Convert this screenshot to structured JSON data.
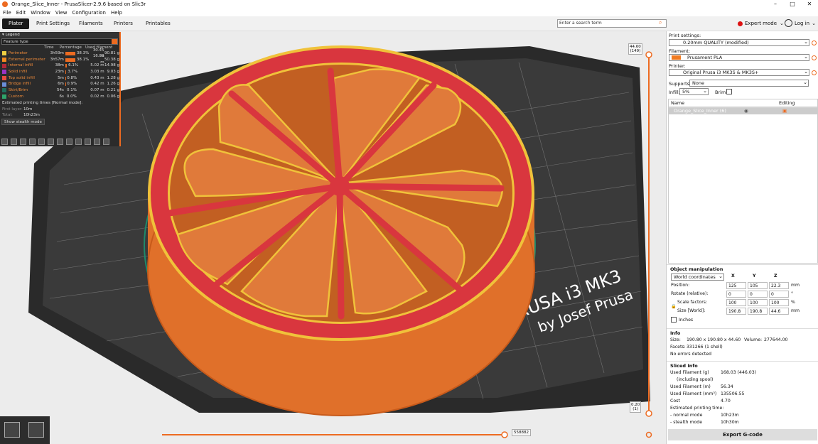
{
  "window": {
    "title": "Orange_Slice_Inner - PrusaSlicer-2.9.6 based on Slic3r",
    "controls": [
      "–",
      "□",
      "✕"
    ]
  },
  "menu": [
    "File",
    "Edit",
    "Window",
    "View",
    "Configuration",
    "Help"
  ],
  "tabs": [
    "Plater",
    "Print Settings",
    "Filaments",
    "Printers",
    "Printables"
  ],
  "search": {
    "placeholder": "Enter a search term"
  },
  "mode": {
    "label": "Expert mode",
    "color": "#d11111"
  },
  "login": {
    "label": "Log in"
  },
  "legend": {
    "title": "Legend",
    "view_type": "Feature type",
    "columns": [
      "Time",
      "Percentage",
      "Used filament"
    ],
    "rows": [
      {
        "name": "Perimeter",
        "color": "#f2d043",
        "time": "3h59m",
        "pct": "38.3%",
        "pct_value": 38.3,
        "len": "30.45 m",
        "weight": "90.81 g"
      },
      {
        "name": "External perimeter",
        "color": "#f58a1f",
        "time": "3h57m",
        "pct": "38.1%",
        "pct_value": 38.1,
        "len": "16.89 m",
        "weight": "50.38 g"
      },
      {
        "name": "Internal infill",
        "color": "#b3283a",
        "time": "38m",
        "pct": "6.1%",
        "pct_value": 6.1,
        "len": "5.02 m",
        "weight": "14.98 g"
      },
      {
        "name": "Solid infill",
        "color": "#9a33c4",
        "time": "23m",
        "pct": "3.7%",
        "pct_value": 3.7,
        "len": "3.03 m",
        "weight": "9.03 g"
      },
      {
        "name": "Top solid infill",
        "color": "#e84a3f",
        "time": "5m",
        "pct": "0.8%",
        "pct_value": 0.8,
        "len": "0.43 m",
        "weight": "1.28 g"
      },
      {
        "name": "Bridge infill",
        "color": "#6b8fd9",
        "time": "6m",
        "pct": "0.9%",
        "pct_value": 0.9,
        "len": "0.42 m",
        "weight": "1.26 g"
      },
      {
        "name": "Skirt/Brim",
        "color": "#1f6e5c",
        "time": "54s",
        "pct": "0.1%",
        "pct_value": 0.1,
        "len": "0.07 m",
        "weight": "0.21 g"
      },
      {
        "name": "Custom",
        "color": "#2ea56b",
        "time": "6s",
        "pct": "0.0%",
        "pct_value": 0.0,
        "len": "0.02 m",
        "weight": "0.06 g"
      }
    ],
    "estimated_label": "Estimated printing times [Normal mode]:",
    "first_layer_label": "First layer:",
    "first_layer_value": "10m",
    "total_label": "Total:",
    "total_value": "10h23m",
    "stealth_button": "Show stealth mode"
  },
  "scene": {
    "bed_text_line1": "RUSA i3  MK3",
    "bed_text_line2": "by Josef Prusa",
    "colors": {
      "bed": "#2a2a2a",
      "model_body": "#e0702a",
      "top_surface": "#d9363e",
      "perimeter": "#f0c23a",
      "background": "#ececec"
    }
  },
  "vertical_slider": {
    "top_label": "44.60\n(149)",
    "top_value": "44.60",
    "top_layer": "(149)",
    "bottom_value": "0.20",
    "bottom_layer": "(1)"
  },
  "horizontal_slider": {
    "value": "558882"
  },
  "sidebar": {
    "print_settings_label": "Print settings:",
    "print_settings_value": "0.20mm QUALITY (modified)",
    "filament_label": "Filament:",
    "filament_value": "Prusament PLA",
    "filament_color": "#f07a20",
    "printer_label": "Printer:",
    "printer_value": "Original Prusa i3 MK3S & MK3S+",
    "supports_label": "Supports:",
    "supports_value": "None",
    "infill_label": "Infill:",
    "infill_value": "5%",
    "brim_label": "Brim:",
    "list_header_name": "Name",
    "list_header_editing": "Editing",
    "object_name": "Orange_Slice_Inner (6)",
    "object_manipulation": {
      "title": "Object manipulation",
      "coords": "World coordinates",
      "axes": [
        "X",
        "Y",
        "Z"
      ],
      "position_label": "Position:",
      "position": [
        "125",
        "105",
        "22.3"
      ],
      "position_unit": "mm",
      "rotate_label": "Rotate (relative):",
      "rotate": [
        "0",
        "0",
        "0"
      ],
      "rotate_unit": "°",
      "scale_label": "Scale factors:",
      "scale": [
        "100",
        "100",
        "100"
      ],
      "scale_unit": "%",
      "size_label": "Size [World]:",
      "size": [
        "190.8",
        "190.8",
        "44.6"
      ],
      "size_unit": "mm",
      "inches_label": "Inches"
    },
    "info": {
      "title": "Info",
      "size_label": "Size:",
      "size_value": "190.80 x 190.80 x 44.60",
      "volume_label": "Volume:",
      "volume_value": "277644.00",
      "facets_label": "Facets:",
      "facets_value": "331266 (1 shell)",
      "errors": "No errors detected"
    },
    "sliced_info": {
      "title": "Sliced Info",
      "rows": [
        {
          "k": "Used Filament (g)",
          "v": "168.03 (446.03)"
        },
        {
          "k": "(including spool)",
          "v": ""
        },
        {
          "k": "Used Filament (m)",
          "v": "56.34"
        },
        {
          "k": "Used Filament (mm³)",
          "v": "135506.55"
        },
        {
          "k": "Cost",
          "v": "4.70"
        },
        {
          "k": "Estimated printing time:",
          "v": ""
        },
        {
          "k": "- normal mode",
          "v": "10h23m"
        },
        {
          "k": "- stealth mode",
          "v": "10h30m"
        }
      ]
    },
    "export_button": "Export G-code"
  }
}
